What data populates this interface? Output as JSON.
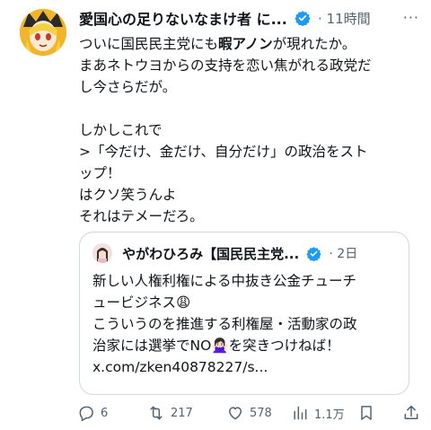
{
  "tweet": {
    "author_name": "愛国心の足りないなまけ者 に...",
    "meta": "· 11時間",
    "more_label": "···",
    "lines": [
      "ついに国民民主党にも",
      "暇アノン",
      "が現れたか。",
      "まあネトウヨからの支持を恋い焦がれる政党だ",
      "し今さらだが。",
      "",
      "しかしこれで",
      ">「今だけ、金だけ、自分だけ」の政治をスト",
      "ップ！",
      "はクソ笑うんよ",
      "それはテメーだろ。"
    ]
  },
  "quote": {
    "author_name": "やがわひろみ【国民民主党...",
    "meta": "· 2日",
    "lines": [
      "新しい人権利権による中抜き公金チューチ",
      "ュービジネス😩",
      "こういうのを推進する利権屋・活動家の政",
      "治家には選挙でNO🙅🏻‍♀️を突きつけねば！",
      "x.com/zken40878227/s..."
    ]
  },
  "actions": {
    "replies": "6",
    "reposts": "217",
    "likes": "578",
    "views": "1.1万"
  },
  "colors": {
    "text": "#0f1419",
    "muted": "#536471",
    "verified": "#1d9bf0",
    "border": "#cfd9de"
  }
}
